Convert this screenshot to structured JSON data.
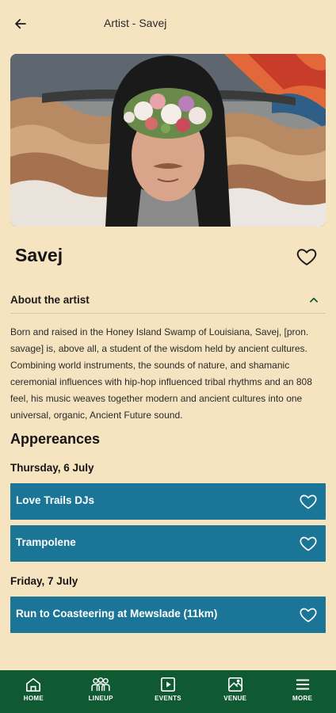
{
  "header": {
    "title": "Artist - Savej",
    "back_icon": "arrow-left-icon"
  },
  "artist": {
    "name": "Savej"
  },
  "about": {
    "title": "About the artist",
    "text": "Born and raised in the Honey Island Swamp of Louisiana, Savej, [pron. savage] is, above all, a student of the wisdom held by ancient cultures. Combining world instruments, the sounds of nature, and shamanic ceremonial influences with hip-hop influenced tribal rhythms and an 808 feel, his music weaves together modern and ancient cultures into one universal, organic, Ancient Future sound."
  },
  "appearances": {
    "title": "Appereances",
    "days": [
      {
        "label": "Thursday, 6 July",
        "events": [
          {
            "name": "Love Trails DJs"
          },
          {
            "name": "Trampolene"
          }
        ]
      },
      {
        "label": "Friday, 7 July",
        "events": [
          {
            "name": "Run to Coasteering at Mewslade (11km)"
          }
        ]
      }
    ]
  },
  "nav": {
    "items": [
      {
        "label": "HOME",
        "icon": "home-icon"
      },
      {
        "label": "LINEUP",
        "icon": "lineup-icon"
      },
      {
        "label": "EVENTS",
        "icon": "events-icon"
      },
      {
        "label": "VENUE",
        "icon": "map-icon"
      },
      {
        "label": "MORE",
        "icon": "menu-icon"
      }
    ]
  },
  "colors": {
    "background": "#f6e3c0",
    "accent_blue": "#1b7596",
    "nav_green": "#0f5a33"
  }
}
